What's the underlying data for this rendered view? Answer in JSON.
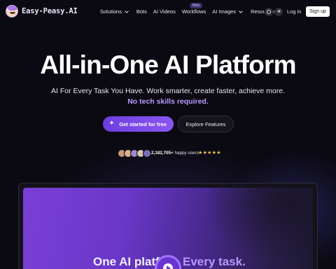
{
  "brand": {
    "name": "Easy-Peasy.AI"
  },
  "nav": {
    "items": [
      {
        "label": "Solutions",
        "dropdown": true
      },
      {
        "label": "Bots",
        "dropdown": false
      },
      {
        "label": "AI Videos",
        "dropdown": false
      },
      {
        "label": "Workflows",
        "dropdown": false
      },
      {
        "label": "AI Images",
        "dropdown": true,
        "badge": "New"
      },
      {
        "label": "Resources",
        "dropdown": true
      }
    ],
    "language_icon": "globe-icon",
    "theme_icon": "sun-icon",
    "login_label": "Log in",
    "signup_label": "Sign up"
  },
  "hero": {
    "title": "All-in-One AI Platform",
    "subtitle": "AI For Every Task You Have. Work smarter, create faster, achieve more.",
    "highlight": "No tech skills required.",
    "primary_cta": "Get started for free",
    "secondary_cta": "Explore Features",
    "social_proof": {
      "count": "2,182,705+",
      "suffix": " happy users",
      "stars": "★★★★★",
      "avatar_colors": [
        "#c79a7a",
        "#e0b08c",
        "#9f8bc9",
        "#d6c2b0",
        "#7d6cb5"
      ]
    }
  },
  "preview": {
    "text_left": "One AI platf",
    "text_right": "Every task.",
    "play_icon": "play-icon"
  },
  "colors": {
    "background": "#0b0a12",
    "accent": "#7c4ae8",
    "highlight": "#b79cff",
    "stars": "#f7c948"
  }
}
